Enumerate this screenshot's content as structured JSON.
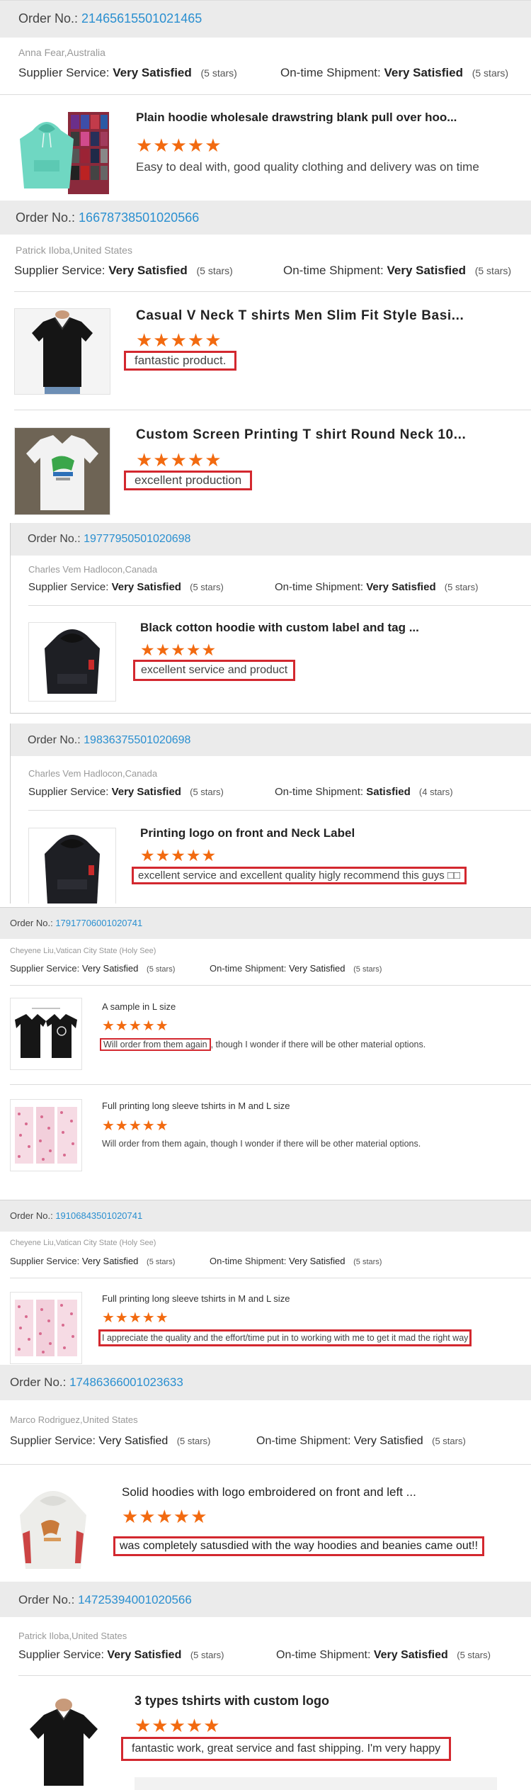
{
  "labels": {
    "order_prefix": "Order No.:",
    "supplier_label": "Supplier Service:",
    "shipment_label": "On-time Shipment:"
  },
  "star_glyphs": "★★★★★",
  "colors": {
    "link_blue": "#2a8fd0",
    "star_orange": "#f26a10",
    "highlight_red": "#d3282f",
    "header_gray": "#ebebeb"
  },
  "orders": [
    {
      "order_no": "21465615501021465",
      "buyer": "Anna Fear,Australia",
      "supplier_rating": "Very Satisfied",
      "supplier_stars": "(5 stars)",
      "shipment_rating": "Very Satisfied",
      "shipment_stars": "(5 stars)",
      "products": [
        {
          "title": "Plain hoodie wholesale drawstring blank pull over hoo...",
          "rating": 5,
          "comment": "Easy to deal with, good quality clothing and delivery was on time",
          "image": "mint-hoodie-stack"
        }
      ]
    },
    {
      "order_no": "16678738501020566",
      "buyer": "Patrick Iloba,United States",
      "supplier_rating": "Very Satisfied",
      "supplier_stars": "(5 stars)",
      "shipment_rating": "Very Satisfied",
      "shipment_stars": "(5 stars)",
      "products": [
        {
          "title": "Casual V Neck T shirts Men Slim Fit Style Basi...",
          "rating": 5,
          "comment": "fantastic product.",
          "image": "black-vneck-tshirt"
        },
        {
          "title": "Custom Screen Printing T shirt Round Neck 10...",
          "rating": 5,
          "comment": "excellent production",
          "image": "white-printed-tshirt"
        }
      ]
    },
    {
      "order_no": "19777950501020698",
      "buyer": "Charles Vem Hadlocon,Canada",
      "supplier_rating": "Very Satisfied",
      "supplier_stars": "(5 stars)",
      "shipment_rating": "Very Satisfied",
      "shipment_stars": "(5 stars)",
      "products": [
        {
          "title": "Black cotton hoodie with custom label and tag ...",
          "rating": 5,
          "comment": "excellent service and product",
          "image": "black-hoodie"
        }
      ]
    },
    {
      "order_no": "19836375501020698",
      "buyer": "Charles Vem Hadlocon,Canada",
      "supplier_rating": "Very Satisfied",
      "supplier_stars": "(5 stars)",
      "shipment_rating": "Satisfied",
      "shipment_stars": "(4 stars)",
      "products": [
        {
          "title": "Printing logo on front and Neck Label",
          "rating": 5,
          "comment": "excellent service and excellent quality higly recommend this guys □□",
          "image": "black-hoodie"
        }
      ]
    },
    {
      "order_no": "17917706001020741",
      "buyer": "Cheyene Liu,Vatican City State (Holy See)",
      "supplier_rating": "Very Satisfied",
      "supplier_stars": "(5 stars)",
      "shipment_rating": "Very Satisfied",
      "shipment_stars": "(5 stars)",
      "products": [
        {
          "title": "A sample in L size",
          "rating": 5,
          "comment_highlight": "Will order from them again",
          "comment_rest": ", though I wonder if there will be other material options.",
          "image": "black-longsleeve-pair"
        },
        {
          "title": "Full printing long sleeve tshirts in M and L size",
          "rating": 5,
          "comment": "Will order from them again, though I wonder if there will be other material options.",
          "image": "pink-print-longsleeves"
        }
      ]
    },
    {
      "order_no": "19106843501020741",
      "buyer": "Cheyene Liu,Vatican City State (Holy See)",
      "supplier_rating": "Very Satisfied",
      "supplier_stars": "(5 stars)",
      "shipment_rating": "Very Satisfied",
      "shipment_stars": "(5 stars)",
      "products": [
        {
          "title": "Full printing long sleeve tshirts in M and L size",
          "rating": 5,
          "comment": "I appreciate the quality and the effort/time put in to working with me to get it mad the right way",
          "image": "pink-print-longsleeves"
        }
      ]
    },
    {
      "order_no": "17486366001023633",
      "buyer": "Marco Rodriguez,United States",
      "supplier_rating": "Very Satisfied",
      "supplier_stars": "(5 stars)",
      "shipment_rating": "Very Satisfied",
      "shipment_stars": "(5 stars)",
      "products": [
        {
          "title": "Solid hoodies with logo embroidered on front and left ...",
          "rating": 5,
          "comment": "was completely satusdied with the way hoodies and beanies came out!!",
          "image": "white-hoodie"
        }
      ]
    },
    {
      "order_no": "14725394001020566",
      "buyer": "Patrick Iloba,United States",
      "supplier_rating": "Very Satisfied",
      "supplier_stars": "(5 stars)",
      "shipment_rating": "Very Satisfied",
      "shipment_stars": "(5 stars)",
      "products": [
        {
          "title": "3 types tshirts with custom logo",
          "rating": 5,
          "comment": "fantastic work, great service and fast shipping. I'm very happy",
          "image": "black-vneck-tshirt"
        }
      ]
    }
  ]
}
